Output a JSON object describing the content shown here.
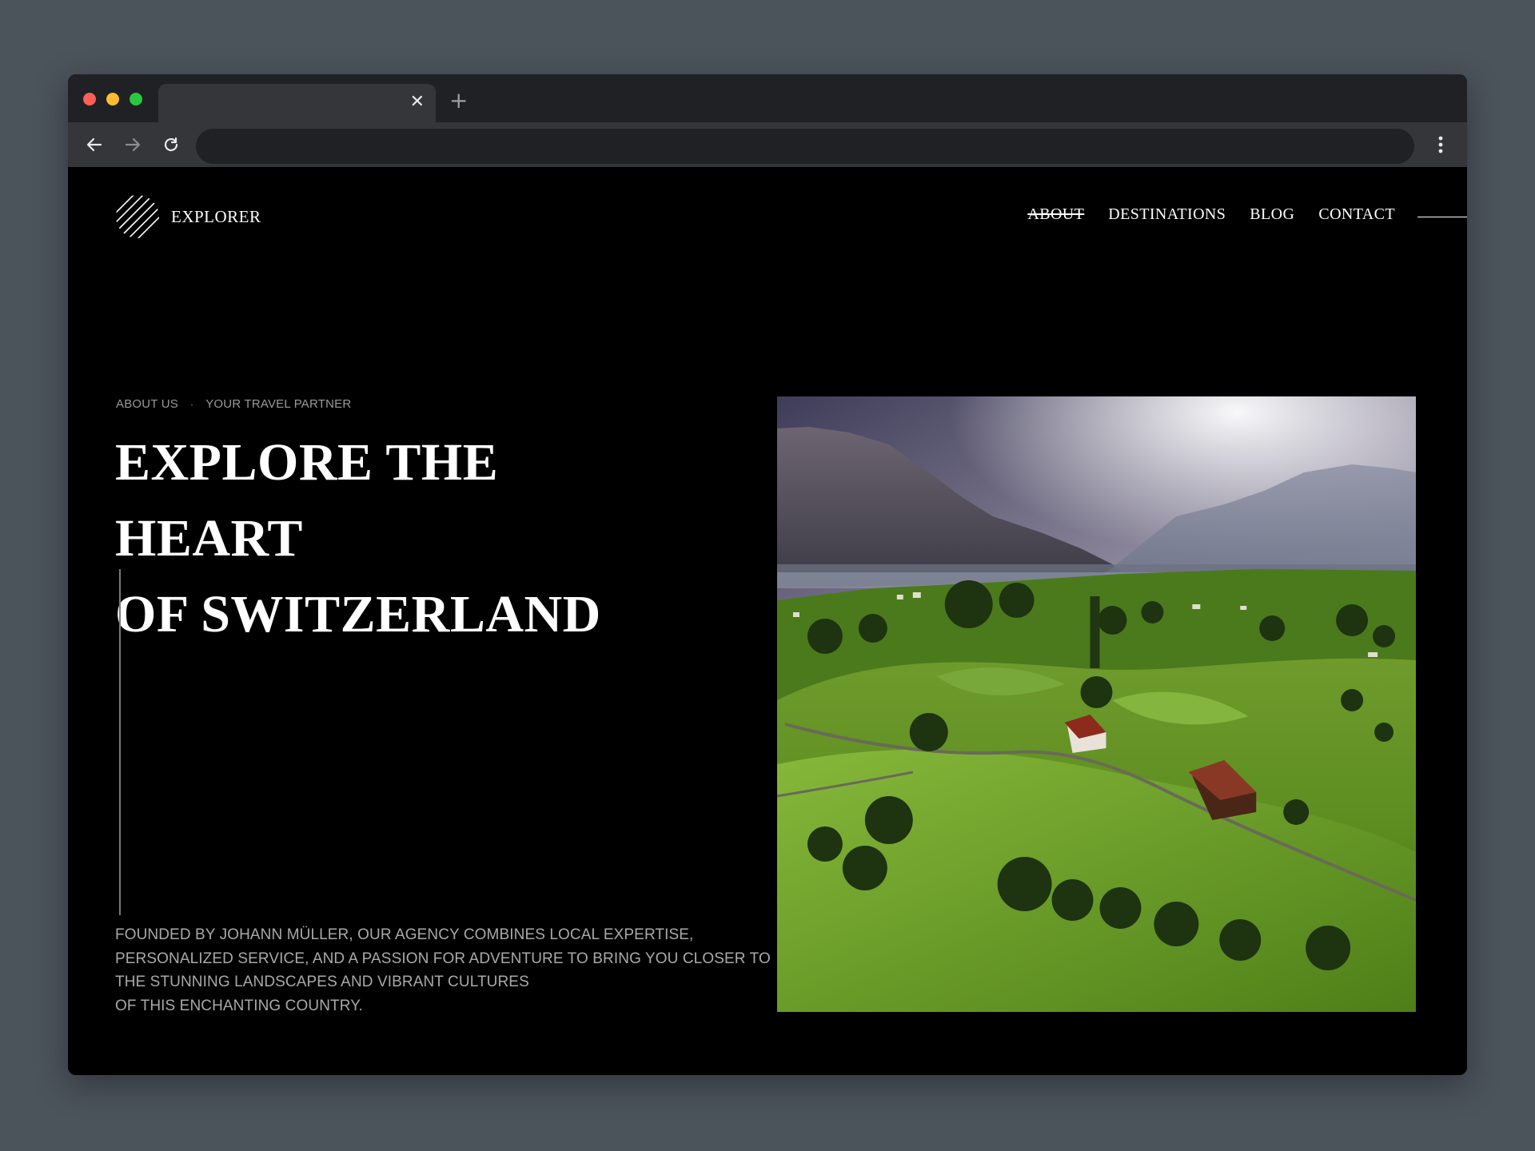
{
  "browser": {
    "tab_close": "✕",
    "new_tab": "+"
  },
  "site": {
    "brand": "EXPLORER",
    "nav": [
      {
        "label": "ABOUT",
        "active": true
      },
      {
        "label": "DESTINATIONS"
      },
      {
        "label": "BLOG"
      },
      {
        "label": "CONTACT"
      }
    ]
  },
  "hero": {
    "crumbs": [
      "ABOUT US",
      "YOUR TRAVEL PARTNER"
    ],
    "crumb_sep": "·",
    "title_lines": [
      "EXPLORE THE HEART",
      "OF SWITZERLAND"
    ],
    "body_lines": [
      "FOUNDED BY JOHANN MÜLLER, OUR AGENCY COMBINES LOCAL EXPERTISE,",
      "PERSONALIZED SERVICE, AND A PASSION FOR ADVENTURE TO BRING YOU CLOSER TO",
      "THE STUNNING LANDSCAPES AND VIBRANT CULTURES",
      "OF THIS ENCHANTING COUNTRY."
    ]
  },
  "colors": {
    "page_bg": "#4b535b",
    "site_bg": "#000000",
    "tabbar": "#202124",
    "toolbar": "#35363a"
  }
}
